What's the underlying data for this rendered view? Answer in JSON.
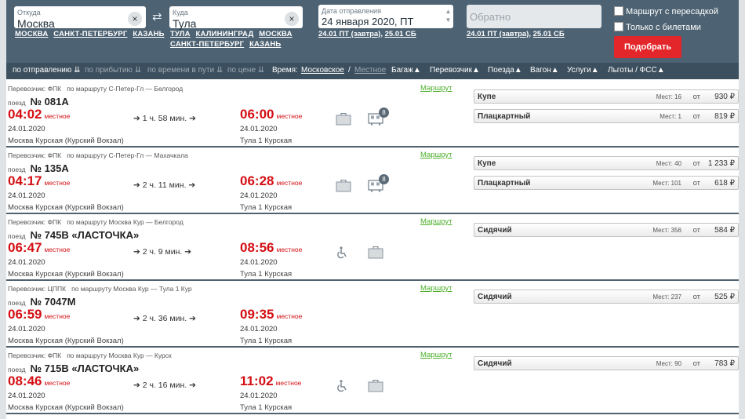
{
  "search": {
    "from": {
      "label": "Откуда",
      "value": "Москва",
      "clear": "×",
      "quick": [
        "МОСКВА",
        "САНКТ-ПЕТЕРБУРГ",
        "КАЗАНЬ"
      ]
    },
    "to": {
      "label": "Куда",
      "value": "Тула",
      "clear": "×",
      "quick_line1": [
        "ТУЛА",
        "КАЛИНИНГРАД",
        "МОСКВА"
      ],
      "quick_line2": [
        "САНКТ-ПЕТЕРБУРГ",
        "КАЗАНЬ"
      ]
    },
    "swap": "⇄",
    "departure": {
      "label": "Дата отправления",
      "value": "24 января 2020, ПТ",
      "quick": [
        "24.01 ПТ (завтра)",
        "25.01 СБ"
      ]
    },
    "return": {
      "placeholder": "Обратно",
      "quick": [
        "24.01 ПТ (завтра)",
        "25.01 СБ"
      ]
    },
    "transfer_label": "Маршрут с пересадкой",
    "tickets_only_label": "Только с билетами",
    "find_button": "Подобрать"
  },
  "sortbar": {
    "by_departure": "по отправлению",
    "by_arrival": "по прибытию",
    "by_travel_time": "по времени в пути",
    "by_price": "по цене",
    "time_label": "Время:",
    "time_moscow": "Московское",
    "time_sep": "/",
    "time_local": "Местное",
    "filters": [
      "Багаж",
      "Перевозчик",
      "Поезда",
      "Вагон",
      "Услуги",
      "Льготы / ФСС"
    ]
  },
  "common": {
    "route_link": "Маршрут",
    "train_prefix": "поезд",
    "local": "местное",
    "from_word": "от",
    "seats_word": "Мест:",
    "currency": "₽"
  },
  "trains": [
    {
      "carrier": "Перевозчик: ФПК",
      "route": "по маршруту С-Петер-Гл — Белгород",
      "number": "№ 081А",
      "dep_time": "04:02",
      "dep_date": "24.01.2020",
      "dep_station": "Москва Курская (Курский Вокзал)",
      "duration": "1 ч. 58 мин.",
      "arr_time": "06:00",
      "arr_date": "24.01.2020",
      "arr_station": "Тула 1 Курская",
      "icons": [
        "baggage",
        "wagon"
      ],
      "wagon_badge": "8",
      "classes": [
        {
          "name": "Купе",
          "seats": "16",
          "price": "930"
        },
        {
          "name": "Плацкартный",
          "seats": "1",
          "price": "819"
        }
      ]
    },
    {
      "carrier": "Перевозчик: ФПК",
      "route": "по маршруту С-Петер-Гл — Махачкала",
      "number": "№ 135А",
      "dep_time": "04:17",
      "dep_date": "24.01.2020",
      "dep_station": "Москва Курская (Курский Вокзал)",
      "duration": "2 ч. 11 мин.",
      "arr_time": "06:28",
      "arr_date": "24.01.2020",
      "arr_station": "Тула 1 Курская",
      "icons": [
        "baggage",
        "wagon"
      ],
      "wagon_badge": "8",
      "classes": [
        {
          "name": "Купе",
          "seats": "40",
          "price": "1 233"
        },
        {
          "name": "Плацкартный",
          "seats": "101",
          "price": "618"
        }
      ]
    },
    {
      "carrier": "Перевозчик: ФПК",
      "route": "по маршруту Москва Кур — Белгород",
      "number": "№ 745В «ЛАСТОЧКА»",
      "dep_time": "06:47",
      "dep_date": "24.01.2020",
      "dep_station": "Москва Курская (Курский Вокзал)",
      "duration": "2 ч. 9 мин.",
      "arr_time": "08:56",
      "arr_date": "24.01.2020",
      "arr_station": "Тула 1 Курская",
      "icons": [
        "wheelchair",
        "baggage"
      ],
      "wagon_badge": "",
      "classes": [
        {
          "name": "Сидячий",
          "seats": "356",
          "price": "584"
        }
      ]
    },
    {
      "carrier": "Перевозчик: ЦППК",
      "route": "по маршруту Москва Кур — Тула 1 Кур",
      "number": "№ 7047М",
      "dep_time": "06:59",
      "dep_date": "24.01.2020",
      "dep_station": "Москва Курская (Курский Вокзал)",
      "duration": "2 ч. 36 мин.",
      "arr_time": "09:35",
      "arr_date": "24.01.2020",
      "arr_station": "Тула 1 Курская",
      "icons": [],
      "wagon_badge": "",
      "classes": [
        {
          "name": "Сидячий",
          "seats": "237",
          "price": "525"
        }
      ]
    },
    {
      "carrier": "Перевозчик: ФПК",
      "route": "по маршруту Москва Кур — Курск",
      "number": "№ 715В «ЛАСТОЧКА»",
      "dep_time": "08:46",
      "dep_date": "24.01.2020",
      "dep_station": "Москва Курская (Курский Вокзал)",
      "duration": "2 ч. 16 мин.",
      "arr_time": "11:02",
      "arr_date": "24.01.2020",
      "arr_station": "Тула 1 Курская",
      "icons": [
        "wheelchair",
        "baggage"
      ],
      "wagon_badge": "",
      "classes": [
        {
          "name": "Сидячий",
          "seats": "90",
          "price": "783"
        }
      ]
    }
  ]
}
